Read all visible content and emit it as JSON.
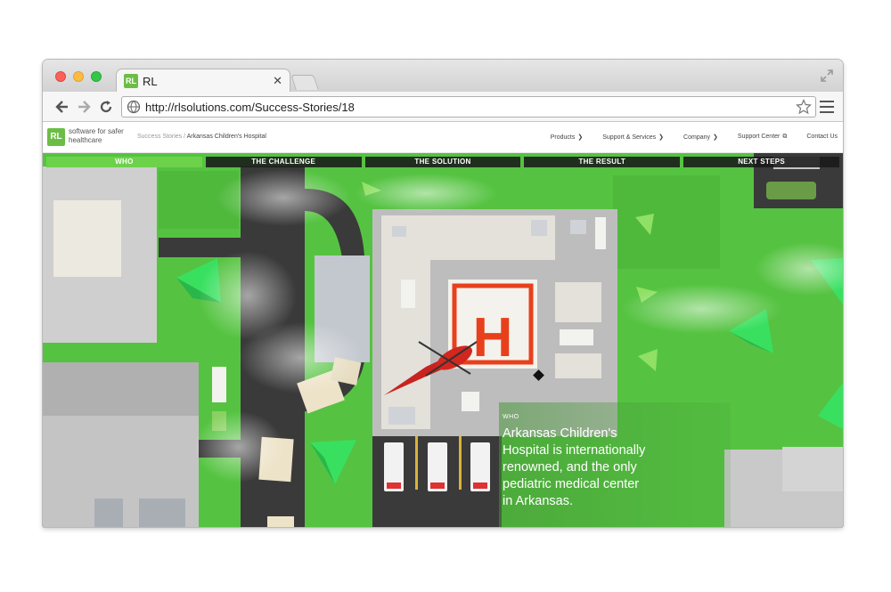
{
  "browser": {
    "tab_title": "RL",
    "tab_favicon": "RL",
    "url": "http://rlsolutions.com/Success-Stories/18",
    "close_label": "✕"
  },
  "site": {
    "logo_text": "RL",
    "tagline": "software for safer healthcare",
    "breadcrumb_parent": "Success Stories",
    "breadcrumb_sep": " / ",
    "breadcrumb_current": "Arkansas Children's Hospital",
    "nav": [
      {
        "label": "Products",
        "has_chevron": true
      },
      {
        "label": "Support & Services",
        "has_chevron": true
      },
      {
        "label": "Company",
        "has_chevron": true
      },
      {
        "label": "Support Center",
        "has_external": true
      },
      {
        "label": "Contact Us"
      }
    ]
  },
  "sections": [
    {
      "label": "WHO",
      "active": true
    },
    {
      "label": "THE CHALLENGE",
      "active": false
    },
    {
      "label": "THE SOLUTION",
      "active": false
    },
    {
      "label": "THE RESULT",
      "active": false
    },
    {
      "label": "NEXT STEPS",
      "active": false
    }
  ],
  "story": {
    "label": "WHO",
    "body": "Arkansas Children's Hospital is internationally renowned, and the only pediatric medical center in Arkansas."
  },
  "scene": {
    "helipad_letter": "H",
    "colors": {
      "grass": "#55c341",
      "road": "#3a3a3a",
      "building": "#d8d8d8",
      "helipad": "#e8401c",
      "accent_green": "#6cd24a"
    }
  }
}
